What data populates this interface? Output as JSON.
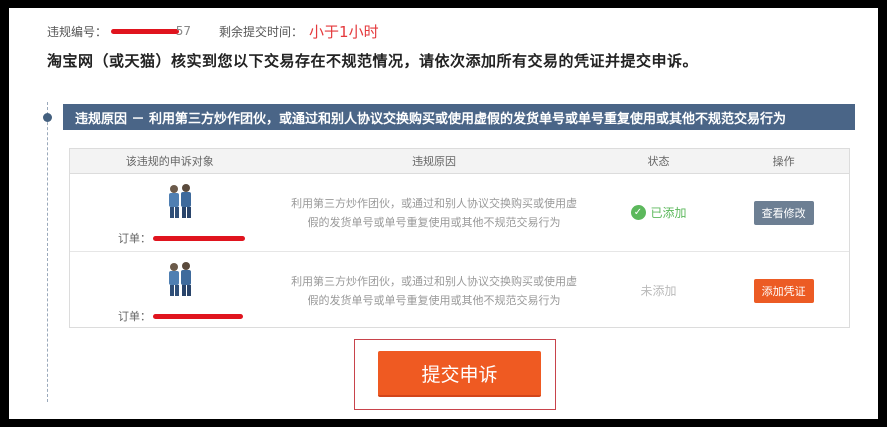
{
  "header": {
    "violation_no_label": "违规编号：",
    "violation_no_tail": "57",
    "remaining_label": "剩余提交时间：",
    "remaining_value": "小于1小时"
  },
  "notice": "淘宝网（或天猫）核实到您以下交易存在不规范情况，请依次添加所有交易的凭证并提交申诉。",
  "banner": "违规原因 － 利用第三方炒作团伙，或通过和别人协议交换购买或使用虚假的发货单号或单号重复使用或其他不规范交易行为",
  "table": {
    "columns": [
      "该违规的申诉对象",
      "违规原因",
      "状态",
      "操作"
    ],
    "rows": [
      {
        "order_label": "订单：",
        "reason": "利用第三方炒作团伙，或通过和别人协议交换购买或使用虚假的发货单号或单号重复使用或其他不规范交易行为",
        "status": "已添加",
        "action": "查看修改"
      },
      {
        "order_label": "订单：",
        "reason": "利用第三方炒作团伙，或通过和别人协议交换购买或使用虚假的发货单号或单号重复使用或其他不规范交易行为",
        "status": "未添加",
        "action": "添加凭证"
      }
    ]
  },
  "submit_label": "提交申诉",
  "colors": {
    "banner": "#4a6587",
    "accent_red": "#e4393c",
    "submit": "#ef5a22",
    "status_ok": "#5cb85c",
    "redaction": "#e0141e"
  },
  "icons": {
    "status_ok": "check-circle-icon",
    "product": "product-thumbnail"
  }
}
